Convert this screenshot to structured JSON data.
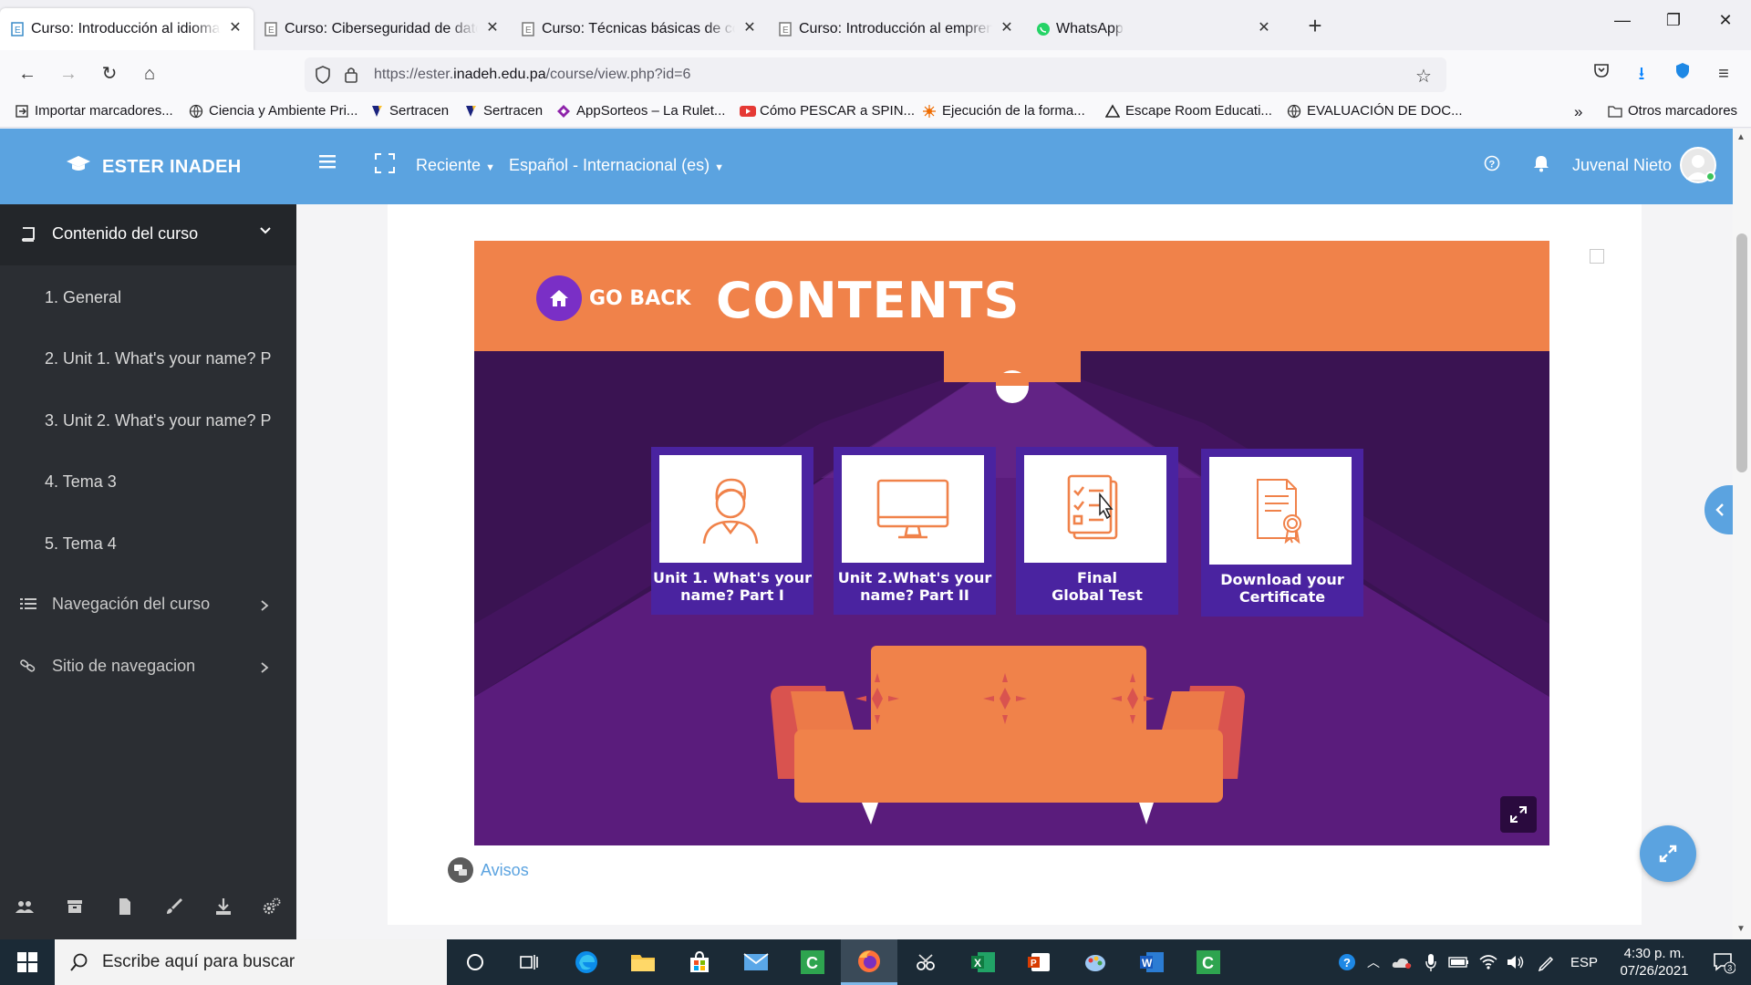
{
  "browser": {
    "tabs": [
      {
        "title": "Curso: Introducción al idioma in",
        "active": true
      },
      {
        "title": "Curso: Ciberseguridad de datos",
        "active": false
      },
      {
        "title": "Curso: Técnicas básicas de cocin",
        "active": false
      },
      {
        "title": "Curso: Introducción al emprendi",
        "active": false
      },
      {
        "title": "WhatsApp",
        "active": false
      }
    ],
    "url_prefix": "https://ester.",
    "url_domain": "inadeh.edu.pa",
    "url_path": "/course/view.php?id=6",
    "bookmarks": [
      "Importar marcadores...",
      "Ciencia y Ambiente Pri...",
      "Sertracen",
      "Sertracen",
      "AppSorteos – La Rulet...",
      "Cómo PESCAR a SPIN...",
      "Ejecución de la forma...",
      "Escape Room Educati...",
      "EVALUACIÓN DE DOC...",
      "Otros marcadores"
    ]
  },
  "header": {
    "brand": "ESTER INADEH",
    "recent": "Reciente",
    "language": "Español - Internacional (es)",
    "user": "Juvenal Nieto"
  },
  "sidebar": {
    "title": "Contenido del curso",
    "items": [
      "1. General",
      "2. Unit 1. What's your name? P",
      "3. Unit 2. What's your name? P",
      "4. Tema 3",
      "5. Tema 4"
    ],
    "nav": [
      "Navegación del curso",
      "Sitio de navegacion"
    ]
  },
  "h5p": {
    "go_back": "GO BACK",
    "title": "CONTENTS",
    "tiles": [
      {
        "line1": "Unit 1. What's your",
        "line2": "name? Part I"
      },
      {
        "line1": "Unit 2.What's your",
        "line2": "name? Part II"
      },
      {
        "line1": "Final",
        "line2": "Global Test"
      },
      {
        "line1": "Download your",
        "line2": "Certificate"
      }
    ]
  },
  "avisos": "Avisos",
  "taskbar": {
    "search_placeholder": "Escribe aquí para buscar",
    "lang": "ESP",
    "time": "4:30 p. m.",
    "date": "07/26/2021",
    "notifications": "3"
  },
  "colors": {
    "header_blue": "#5ba3e0",
    "sidebar_dark": "#2b2e33",
    "h5p_orange": "#f0824a",
    "h5p_purple": "#3a1352",
    "tile_purple": "#4a23a0"
  }
}
